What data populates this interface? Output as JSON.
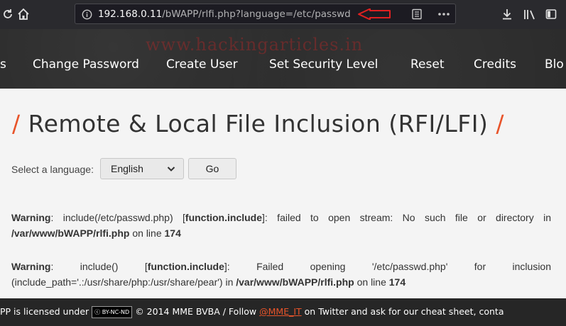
{
  "browser": {
    "url_host": "192.168.0.11",
    "url_path": "/bWAPP/rlfi.php?language=/etc/passwd"
  },
  "nav": {
    "watermark": "www.hackingarticles.in",
    "items": [
      "s",
      "Change Password",
      "Create User",
      "Set Security Level",
      "Reset",
      "Credits",
      "Blo"
    ]
  },
  "page": {
    "title": "Remote & Local File Inclusion (RFI/LFI)",
    "slash": "/",
    "language_label": "Select a language:",
    "language_selected": "English",
    "go_label": "Go"
  },
  "warnings": [
    {
      "label": "Warning",
      "text1": ": include(/etc/passwd.php) [",
      "func": "function.include",
      "text2": "]: failed to open stream: No such file or directory in ",
      "path": "/var/www/bWAPP/rlfi.php",
      "text3": " on line ",
      "line": "174"
    },
    {
      "label": "Warning",
      "text1": ": include() [",
      "func": "function.include",
      "text2": "]: Failed opening '/etc/passwd.php' for inclusion (include_path='.:/usr/share/php:/usr/share/pear') in ",
      "path": "/var/www/bWAPP/rlfi.php",
      "text3": " on line ",
      "line": "174"
    }
  ],
  "footer": {
    "text_before": "PP is licensed under",
    "badge": "BY-NC-ND",
    "text_mid": "© 2014 MME BVBA / Follow",
    "link": "@MME_IT",
    "text_after": "on Twitter and ask for our cheat sheet, conta"
  }
}
